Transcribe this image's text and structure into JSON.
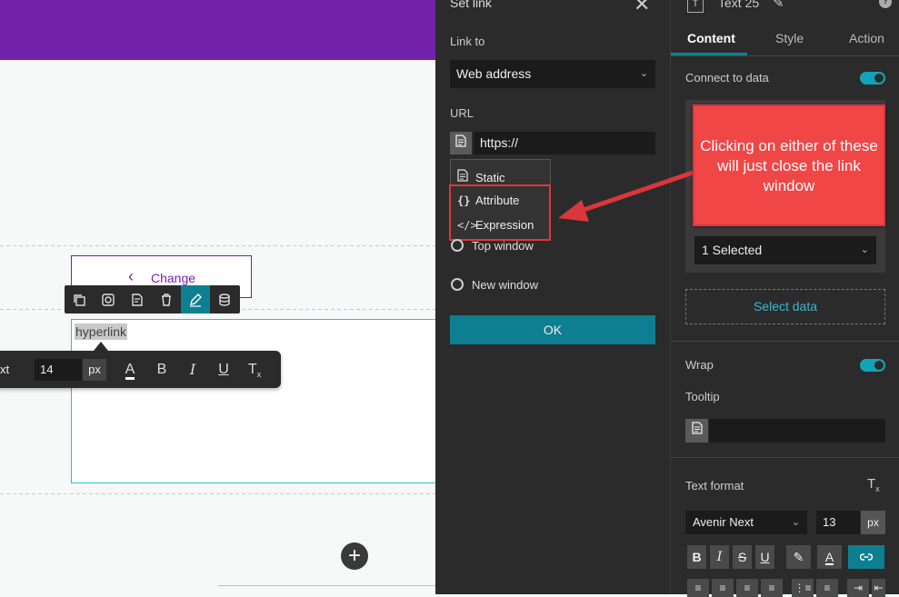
{
  "canvas": {
    "change_button": "Change",
    "hyperlink_text": "hyperlink",
    "format_toolbar": {
      "font_fragment": "xt",
      "font_size": "14",
      "unit": "px"
    }
  },
  "link_panel": {
    "title": "Set link",
    "link_to_label": "Link to",
    "link_to_value": "Web address",
    "url_label": "URL",
    "url_value": "https://",
    "dropdown_items": [
      {
        "icon": "static-icon",
        "label": "Static"
      },
      {
        "icon": "attribute-icon",
        "label": "Attribute"
      },
      {
        "icon": "expression-icon",
        "label": "Expression"
      }
    ],
    "radio_options": [
      "Top window",
      "New window"
    ],
    "ok_label": "OK"
  },
  "right_panel": {
    "widget_title": "Text 25",
    "tabs": [
      "Content",
      "Style",
      "Action"
    ],
    "active_tab": "Content",
    "connect_to_data": "Connect to data",
    "selected_value": "1 Selected",
    "select_data": "Select data",
    "wrap_label": "Wrap",
    "tooltip_label": "Tooltip",
    "text_format_label": "Text format",
    "font_name": "Avenir Next",
    "font_size": "13",
    "unit": "px",
    "accent_color": "#0d7f91"
  },
  "callout": {
    "text": "Clicking on either of these will just close the link window",
    "color": "#f14646"
  }
}
